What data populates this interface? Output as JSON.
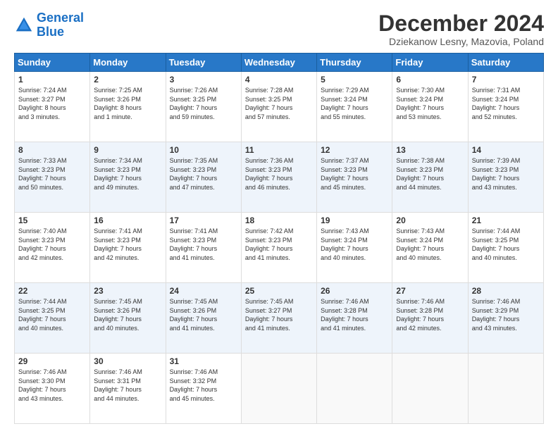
{
  "logo": {
    "line1": "General",
    "line2": "Blue"
  },
  "title": "December 2024",
  "subtitle": "Dziekanow Lesny, Mazovia, Poland",
  "days_of_week": [
    "Sunday",
    "Monday",
    "Tuesday",
    "Wednesday",
    "Thursday",
    "Friday",
    "Saturday"
  ],
  "weeks": [
    [
      {
        "day": 1,
        "info": "Sunrise: 7:24 AM\nSunset: 3:27 PM\nDaylight: 8 hours\nand 3 minutes."
      },
      {
        "day": 2,
        "info": "Sunrise: 7:25 AM\nSunset: 3:26 PM\nDaylight: 8 hours\nand 1 minute."
      },
      {
        "day": 3,
        "info": "Sunrise: 7:26 AM\nSunset: 3:25 PM\nDaylight: 7 hours\nand 59 minutes."
      },
      {
        "day": 4,
        "info": "Sunrise: 7:28 AM\nSunset: 3:25 PM\nDaylight: 7 hours\nand 57 minutes."
      },
      {
        "day": 5,
        "info": "Sunrise: 7:29 AM\nSunset: 3:24 PM\nDaylight: 7 hours\nand 55 minutes."
      },
      {
        "day": 6,
        "info": "Sunrise: 7:30 AM\nSunset: 3:24 PM\nDaylight: 7 hours\nand 53 minutes."
      },
      {
        "day": 7,
        "info": "Sunrise: 7:31 AM\nSunset: 3:24 PM\nDaylight: 7 hours\nand 52 minutes."
      }
    ],
    [
      {
        "day": 8,
        "info": "Sunrise: 7:33 AM\nSunset: 3:23 PM\nDaylight: 7 hours\nand 50 minutes."
      },
      {
        "day": 9,
        "info": "Sunrise: 7:34 AM\nSunset: 3:23 PM\nDaylight: 7 hours\nand 49 minutes."
      },
      {
        "day": 10,
        "info": "Sunrise: 7:35 AM\nSunset: 3:23 PM\nDaylight: 7 hours\nand 47 minutes."
      },
      {
        "day": 11,
        "info": "Sunrise: 7:36 AM\nSunset: 3:23 PM\nDaylight: 7 hours\nand 46 minutes."
      },
      {
        "day": 12,
        "info": "Sunrise: 7:37 AM\nSunset: 3:23 PM\nDaylight: 7 hours\nand 45 minutes."
      },
      {
        "day": 13,
        "info": "Sunrise: 7:38 AM\nSunset: 3:23 PM\nDaylight: 7 hours\nand 44 minutes."
      },
      {
        "day": 14,
        "info": "Sunrise: 7:39 AM\nSunset: 3:23 PM\nDaylight: 7 hours\nand 43 minutes."
      }
    ],
    [
      {
        "day": 15,
        "info": "Sunrise: 7:40 AM\nSunset: 3:23 PM\nDaylight: 7 hours\nand 42 minutes."
      },
      {
        "day": 16,
        "info": "Sunrise: 7:41 AM\nSunset: 3:23 PM\nDaylight: 7 hours\nand 42 minutes."
      },
      {
        "day": 17,
        "info": "Sunrise: 7:41 AM\nSunset: 3:23 PM\nDaylight: 7 hours\nand 41 minutes."
      },
      {
        "day": 18,
        "info": "Sunrise: 7:42 AM\nSunset: 3:23 PM\nDaylight: 7 hours\nand 41 minutes."
      },
      {
        "day": 19,
        "info": "Sunrise: 7:43 AM\nSunset: 3:24 PM\nDaylight: 7 hours\nand 40 minutes."
      },
      {
        "day": 20,
        "info": "Sunrise: 7:43 AM\nSunset: 3:24 PM\nDaylight: 7 hours\nand 40 minutes."
      },
      {
        "day": 21,
        "info": "Sunrise: 7:44 AM\nSunset: 3:25 PM\nDaylight: 7 hours\nand 40 minutes."
      }
    ],
    [
      {
        "day": 22,
        "info": "Sunrise: 7:44 AM\nSunset: 3:25 PM\nDaylight: 7 hours\nand 40 minutes."
      },
      {
        "day": 23,
        "info": "Sunrise: 7:45 AM\nSunset: 3:26 PM\nDaylight: 7 hours\nand 40 minutes."
      },
      {
        "day": 24,
        "info": "Sunrise: 7:45 AM\nSunset: 3:26 PM\nDaylight: 7 hours\nand 41 minutes."
      },
      {
        "day": 25,
        "info": "Sunrise: 7:45 AM\nSunset: 3:27 PM\nDaylight: 7 hours\nand 41 minutes."
      },
      {
        "day": 26,
        "info": "Sunrise: 7:46 AM\nSunset: 3:28 PM\nDaylight: 7 hours\nand 41 minutes."
      },
      {
        "day": 27,
        "info": "Sunrise: 7:46 AM\nSunset: 3:28 PM\nDaylight: 7 hours\nand 42 minutes."
      },
      {
        "day": 28,
        "info": "Sunrise: 7:46 AM\nSunset: 3:29 PM\nDaylight: 7 hours\nand 43 minutes."
      }
    ],
    [
      {
        "day": 29,
        "info": "Sunrise: 7:46 AM\nSunset: 3:30 PM\nDaylight: 7 hours\nand 43 minutes."
      },
      {
        "day": 30,
        "info": "Sunrise: 7:46 AM\nSunset: 3:31 PM\nDaylight: 7 hours\nand 44 minutes."
      },
      {
        "day": 31,
        "info": "Sunrise: 7:46 AM\nSunset: 3:32 PM\nDaylight: 7 hours\nand 45 minutes."
      },
      null,
      null,
      null,
      null
    ]
  ]
}
